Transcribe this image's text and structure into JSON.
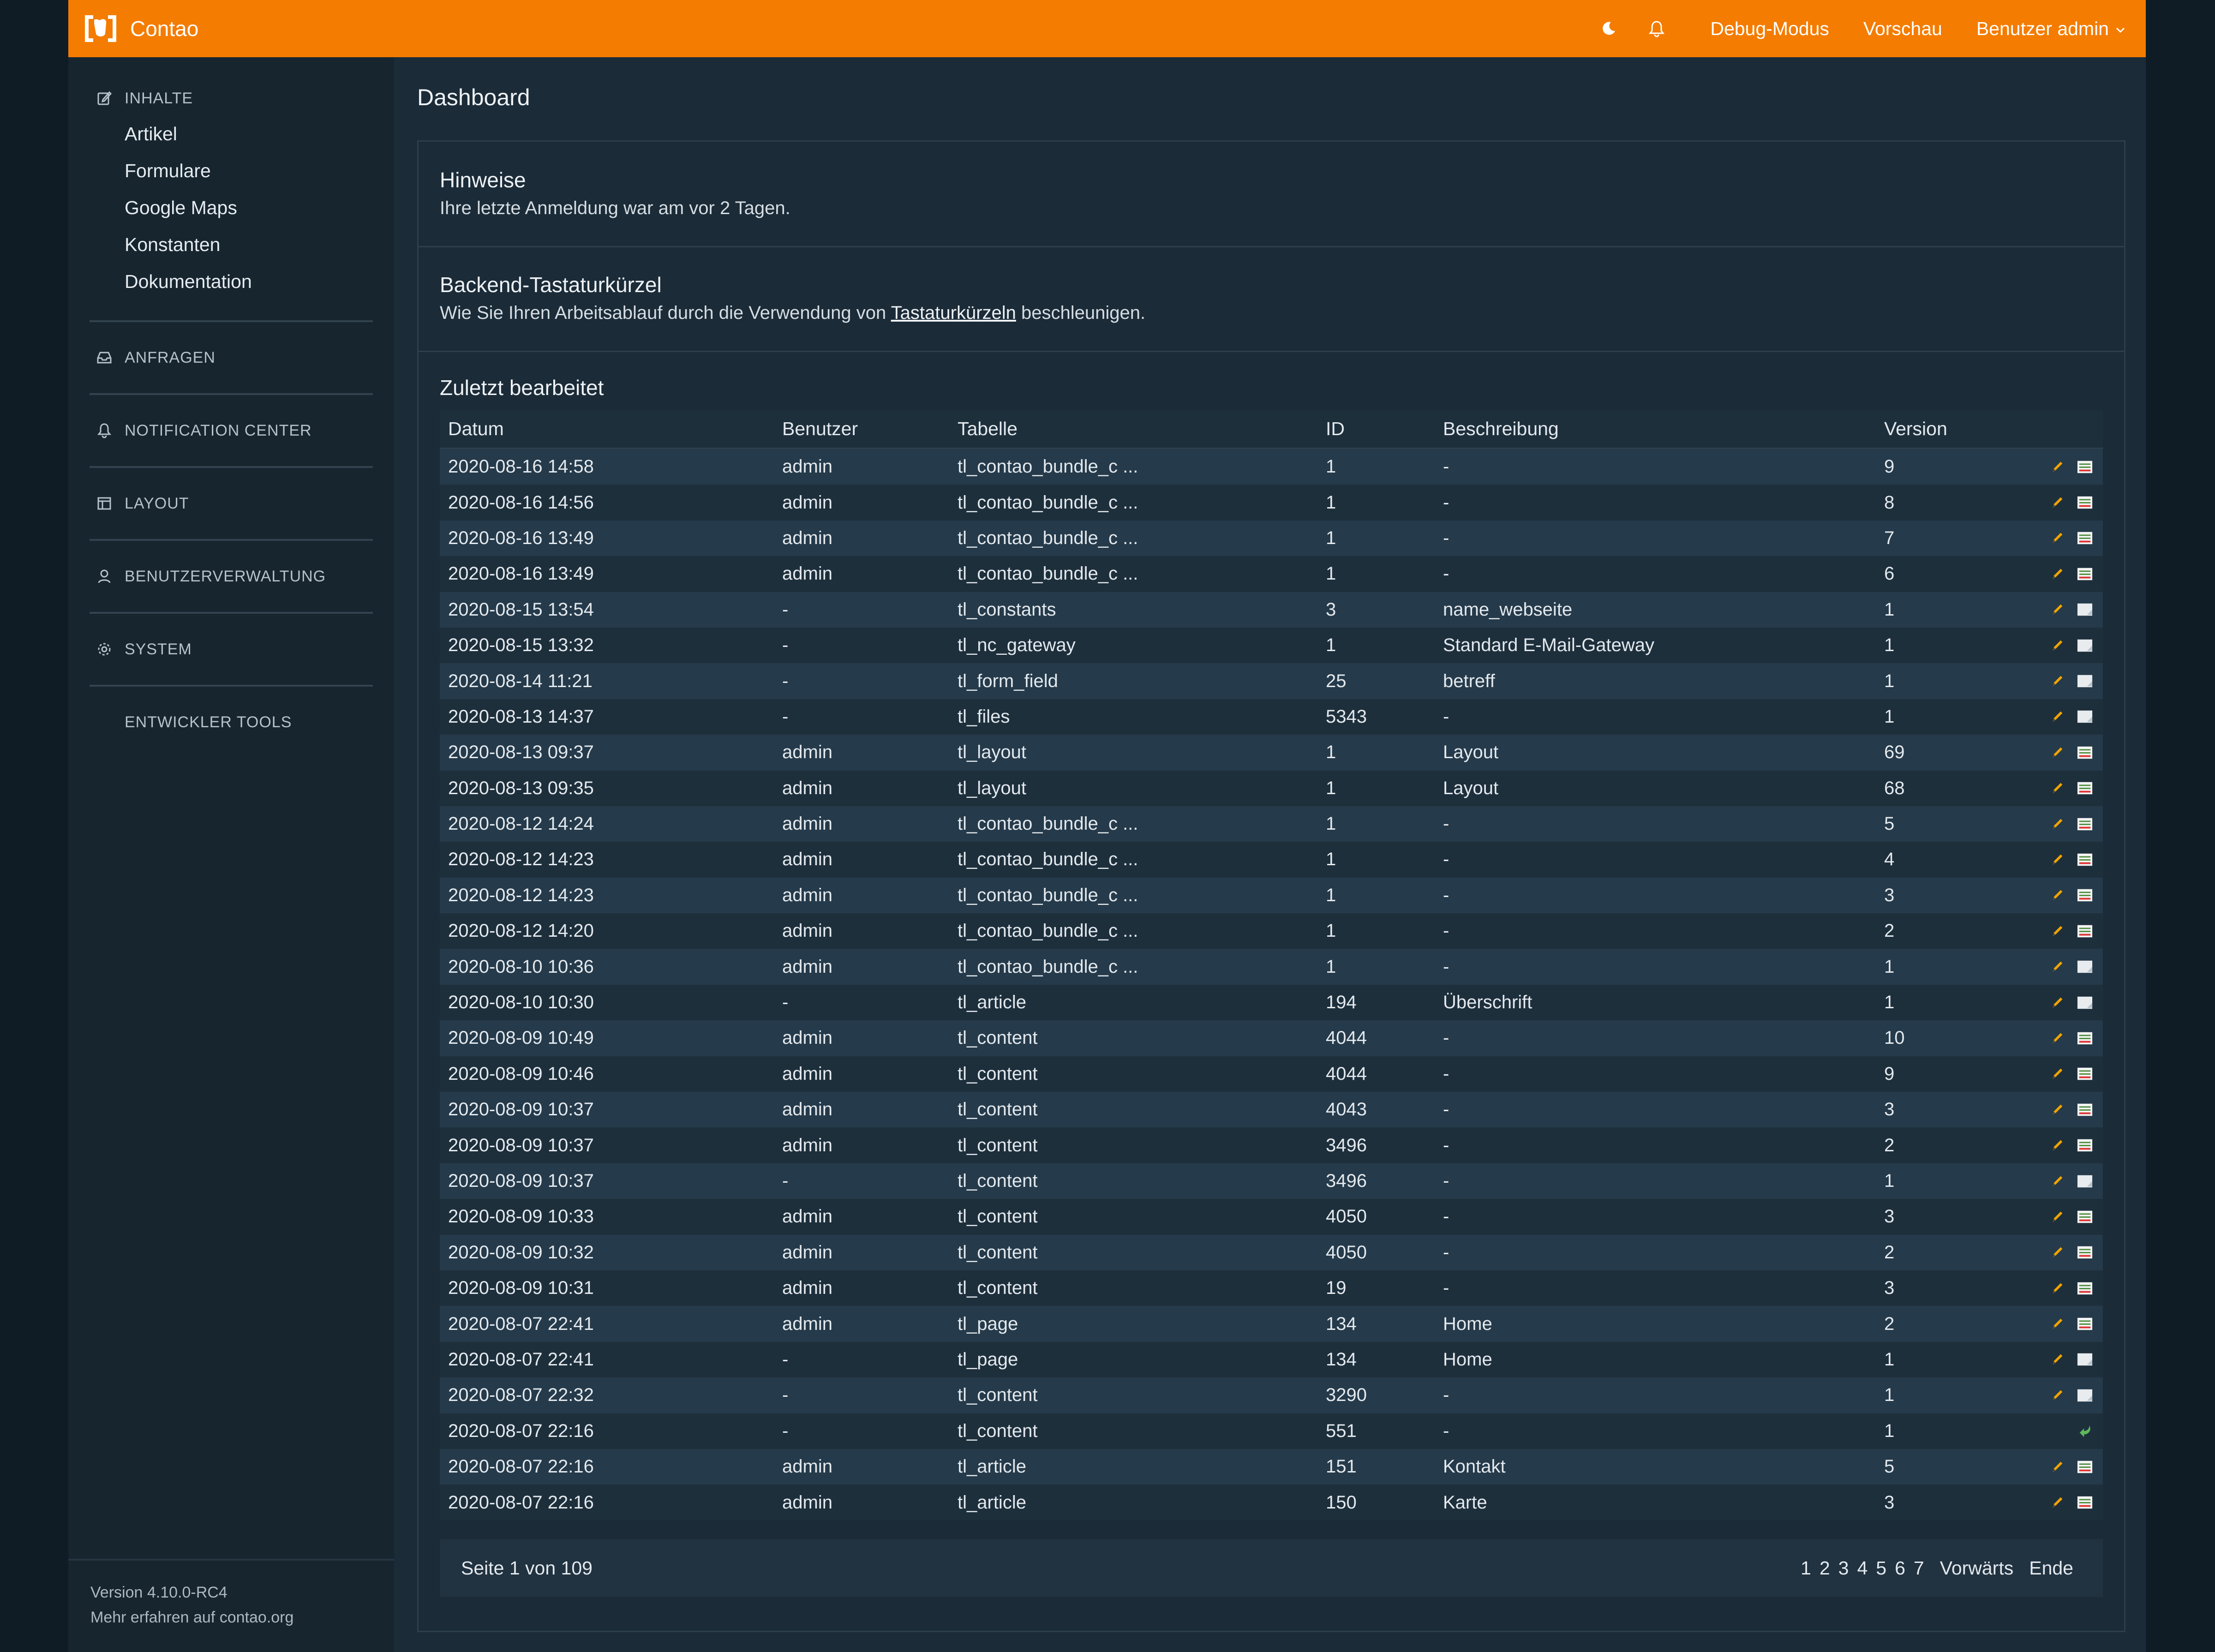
{
  "header": {
    "brand": "Contao",
    "links": [
      "Debug-Modus",
      "Vorschau",
      "Benutzer admin"
    ],
    "colors": {
      "accent": "#f47c00"
    }
  },
  "sidebar": {
    "groups": [
      {
        "label": "INHALTE",
        "icon": "edit-icon",
        "items": [
          "Artikel",
          "Formulare",
          "Google Maps",
          "Konstanten",
          "Dokumentation"
        ]
      },
      {
        "label": "ANFRAGEN",
        "icon": "inbox-icon"
      },
      {
        "label": "NOTIFICATION CENTER",
        "icon": "bell-icon"
      },
      {
        "label": "LAYOUT",
        "icon": "layout-icon"
      },
      {
        "label": "BENUTZERVERWALTUNG",
        "icon": "user-icon"
      },
      {
        "label": "SYSTEM",
        "icon": "gear-icon"
      },
      {
        "label": "ENTWICKLER TOOLS",
        "icon": ""
      }
    ],
    "footer": {
      "version": "Version 4.10.0-RC4",
      "more": "Mehr erfahren auf contao.org"
    }
  },
  "main": {
    "title": "Dashboard",
    "notices": {
      "title": "Hinweise",
      "text": "Ihre letzte Anmeldung war am vor 2 Tagen."
    },
    "shortcuts": {
      "title": "Backend-Tastaturkürzel",
      "text_before": "Wie Sie Ihren Arbeitsablauf durch die Verwendung von ",
      "link": "Tastaturkürzeln",
      "text_after": " beschleunigen."
    },
    "recent": {
      "title": "Zuletzt bearbeitet",
      "columns": [
        "Datum",
        "Benutzer",
        "Tabelle",
        "ID",
        "Beschreibung",
        "Version"
      ],
      "rows": [
        {
          "date": "2020-08-16 14:58",
          "user": "admin",
          "table": "tl_contao_bundle_c ...",
          "id": "1",
          "desc": "-",
          "version": "9",
          "diff": true
        },
        {
          "date": "2020-08-16 14:56",
          "user": "admin",
          "table": "tl_contao_bundle_c ...",
          "id": "1",
          "desc": "-",
          "version": "8",
          "diff": true
        },
        {
          "date": "2020-08-16 13:49",
          "user": "admin",
          "table": "tl_contao_bundle_c ...",
          "id": "1",
          "desc": "-",
          "version": "7",
          "diff": true
        },
        {
          "date": "2020-08-16 13:49",
          "user": "admin",
          "table": "tl_contao_bundle_c ...",
          "id": "1",
          "desc": "-",
          "version": "6",
          "diff": true
        },
        {
          "date": "2020-08-15 13:54",
          "user": "-",
          "table": "tl_constants",
          "id": "3",
          "desc": "name_webseite",
          "version": "1",
          "diff": false
        },
        {
          "date": "2020-08-15 13:32",
          "user": "-",
          "table": "tl_nc_gateway",
          "id": "1",
          "desc": "Standard E-Mail-Gateway",
          "version": "1",
          "diff": false
        },
        {
          "date": "2020-08-14 11:21",
          "user": "-",
          "table": "tl_form_field",
          "id": "25",
          "desc": "betreff",
          "version": "1",
          "diff": false
        },
        {
          "date": "2020-08-13 14:37",
          "user": "-",
          "table": "tl_files",
          "id": "5343",
          "desc": "-",
          "version": "1",
          "diff": false
        },
        {
          "date": "2020-08-13 09:37",
          "user": "admin",
          "table": "tl_layout",
          "id": "1",
          "desc": "Layout",
          "version": "69",
          "diff": true
        },
        {
          "date": "2020-08-13 09:35",
          "user": "admin",
          "table": "tl_layout",
          "id": "1",
          "desc": "Layout",
          "version": "68",
          "diff": true
        },
        {
          "date": "2020-08-12 14:24",
          "user": "admin",
          "table": "tl_contao_bundle_c ...",
          "id": "1",
          "desc": "-",
          "version": "5",
          "diff": true
        },
        {
          "date": "2020-08-12 14:23",
          "user": "admin",
          "table": "tl_contao_bundle_c ...",
          "id": "1",
          "desc": "-",
          "version": "4",
          "diff": true
        },
        {
          "date": "2020-08-12 14:23",
          "user": "admin",
          "table": "tl_contao_bundle_c ...",
          "id": "1",
          "desc": "-",
          "version": "3",
          "diff": true
        },
        {
          "date": "2020-08-12 14:20",
          "user": "admin",
          "table": "tl_contao_bundle_c ...",
          "id": "1",
          "desc": "-",
          "version": "2",
          "diff": true
        },
        {
          "date": "2020-08-10 10:36",
          "user": "admin",
          "table": "tl_contao_bundle_c ...",
          "id": "1",
          "desc": "-",
          "version": "1",
          "diff": false
        },
        {
          "date": "2020-08-10 10:30",
          "user": "-",
          "table": "tl_article",
          "id": "194",
          "desc": "Überschrift",
          "version": "1",
          "diff": false
        },
        {
          "date": "2020-08-09 10:49",
          "user": "admin",
          "table": "tl_content",
          "id": "4044",
          "desc": "-",
          "version": "10",
          "diff": true
        },
        {
          "date": "2020-08-09 10:46",
          "user": "admin",
          "table": "tl_content",
          "id": "4044",
          "desc": "-",
          "version": "9",
          "diff": true
        },
        {
          "date": "2020-08-09 10:37",
          "user": "admin",
          "table": "tl_content",
          "id": "4043",
          "desc": "-",
          "version": "3",
          "diff": true
        },
        {
          "date": "2020-08-09 10:37",
          "user": "admin",
          "table": "tl_content",
          "id": "3496",
          "desc": "-",
          "version": "2",
          "diff": true
        },
        {
          "date": "2020-08-09 10:37",
          "user": "-",
          "table": "tl_content",
          "id": "3496",
          "desc": "-",
          "version": "1",
          "diff": false
        },
        {
          "date": "2020-08-09 10:33",
          "user": "admin",
          "table": "tl_content",
          "id": "4050",
          "desc": "-",
          "version": "3",
          "diff": true
        },
        {
          "date": "2020-08-09 10:32",
          "user": "admin",
          "table": "tl_content",
          "id": "4050",
          "desc": "-",
          "version": "2",
          "diff": true
        },
        {
          "date": "2020-08-09 10:31",
          "user": "admin",
          "table": "tl_content",
          "id": "19",
          "desc": "-",
          "version": "3",
          "diff": true
        },
        {
          "date": "2020-08-07 22:41",
          "user": "admin",
          "table": "tl_page",
          "id": "134",
          "desc": "Home",
          "version": "2",
          "diff": true
        },
        {
          "date": "2020-08-07 22:41",
          "user": "-",
          "table": "tl_page",
          "id": "134",
          "desc": "Home",
          "version": "1",
          "diff": false
        },
        {
          "date": "2020-08-07 22:32",
          "user": "-",
          "table": "tl_content",
          "id": "3290",
          "desc": "-",
          "version": "1",
          "diff": false
        },
        {
          "date": "2020-08-07 22:16",
          "user": "-",
          "table": "tl_content",
          "id": "551",
          "desc": "-",
          "version": "1",
          "diff": false,
          "restore": true
        },
        {
          "date": "2020-08-07 22:16",
          "user": "admin",
          "table": "tl_article",
          "id": "151",
          "desc": "Kontakt",
          "version": "5",
          "diff": true
        },
        {
          "date": "2020-08-07 22:16",
          "user": "admin",
          "table": "tl_article",
          "id": "150",
          "desc": "Karte",
          "version": "3",
          "diff": true
        }
      ]
    },
    "pagination": {
      "info": "Seite 1 von 109",
      "pages": [
        "1",
        "2",
        "3",
        "4",
        "5",
        "6",
        "7"
      ],
      "next": "Vorwärts",
      "last": "Ende"
    }
  }
}
